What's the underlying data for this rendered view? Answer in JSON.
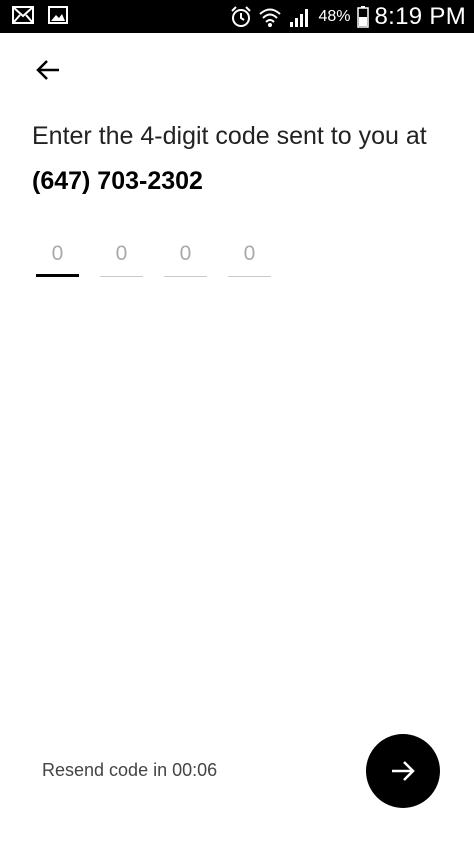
{
  "status_bar": {
    "icons_left": [
      "mail-icon",
      "image-icon"
    ],
    "icons_right": [
      "alarm-icon",
      "wifi-icon",
      "signal-icon",
      "battery-icon"
    ],
    "battery_percent": "48%",
    "time": "8:19 PM"
  },
  "nav": {
    "back_icon": "arrow-left-icon"
  },
  "prompt": {
    "text": "Enter the 4-digit code sent to you at",
    "phone": "(647) 703-2302"
  },
  "code": {
    "digits": [
      {
        "placeholder": "0",
        "active": true
      },
      {
        "placeholder": "0",
        "active": false
      },
      {
        "placeholder": "0",
        "active": false
      },
      {
        "placeholder": "0",
        "active": false
      }
    ]
  },
  "footer": {
    "resend_text": "Resend code in 00:06",
    "next_icon": "arrow-right-icon"
  },
  "colors": {
    "status_bar_bg": "#000000",
    "next_button_bg": "#000000",
    "placeholder": "#a9a9a9"
  }
}
